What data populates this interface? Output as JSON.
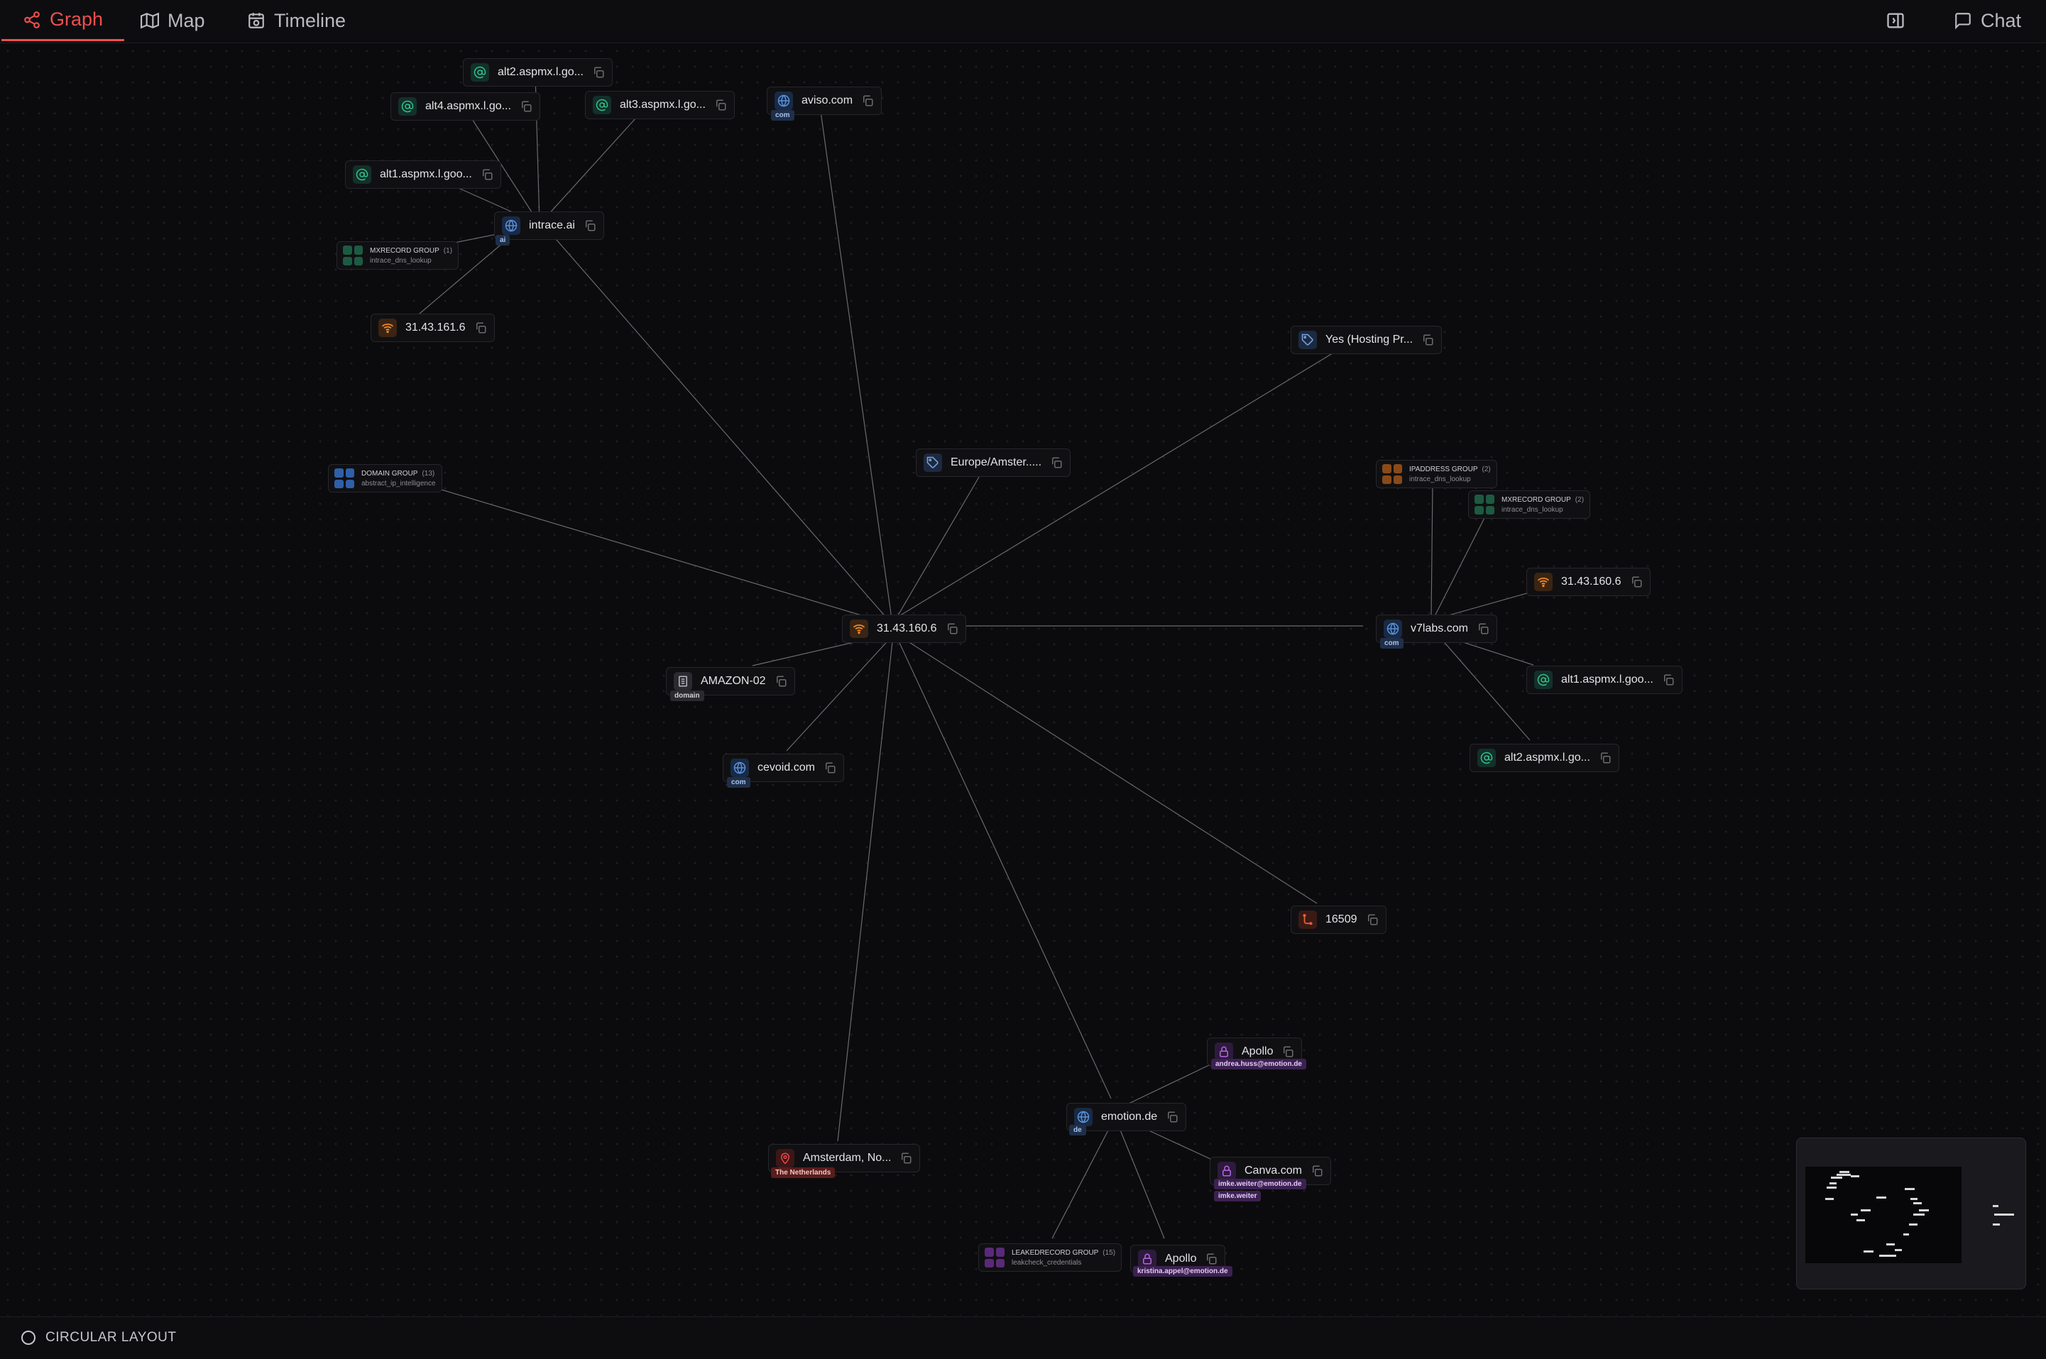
{
  "tabs": [
    {
      "label": "Graph",
      "icon": "graph-icon",
      "active": true
    },
    {
      "label": "Map",
      "icon": "map-icon",
      "active": false
    },
    {
      "label": "Timeline",
      "icon": "timeline-icon",
      "active": false
    }
  ],
  "header_right": {
    "panel_toggle_icon": "panel-toggle-icon",
    "chat_label": "Chat"
  },
  "nodes": {
    "center_ip": {
      "label": "31.43.160.6",
      "icon": "ip-icon"
    },
    "intrace": {
      "label": "intrace.ai",
      "icon": "domain-icon",
      "tag": "ai"
    },
    "alt2_intrace": {
      "label": "alt2.aspmx.l.go...",
      "icon": "mx-icon"
    },
    "alt4_intrace": {
      "label": "alt4.aspmx.l.go...",
      "icon": "mx-icon"
    },
    "alt3_intrace": {
      "label": "alt3.aspmx.l.go...",
      "icon": "mx-icon"
    },
    "alt1_intrace": {
      "label": "alt1.aspmx.l.goo...",
      "icon": "mx-icon"
    },
    "ip_161": {
      "label": "31.43.161.6",
      "icon": "ip-icon"
    },
    "aviso": {
      "label": "aviso.com",
      "icon": "domain-icon",
      "tag": "com"
    },
    "yes_hosting": {
      "label": "Yes (Hosting Pr...",
      "icon": "tag-icon"
    },
    "europe": {
      "label": "Europe/Amster.....",
      "icon": "tag-icon"
    },
    "v7labs": {
      "label": "v7labs.com",
      "icon": "domain-icon",
      "tag": "com"
    },
    "ip_v7": {
      "label": "31.43.160.6",
      "icon": "ip-icon"
    },
    "alt1_v7": {
      "label": "alt1.aspmx.l.goo...",
      "icon": "mx-icon"
    },
    "alt2_v7": {
      "label": "alt2.aspmx.l.go...",
      "icon": "mx-icon"
    },
    "amazon": {
      "label": "AMAZON-02",
      "icon": "building-icon",
      "tag": "domain"
    },
    "cevoid": {
      "label": "cevoid.com",
      "icon": "domain-icon",
      "tag": "com"
    },
    "asn": {
      "label": "16509",
      "icon": "asn-icon"
    },
    "emotion": {
      "label": "emotion.de",
      "icon": "domain-icon",
      "tag": "de"
    },
    "apollo1": {
      "label": "Apollo",
      "icon": "lock-icon",
      "tag": "andrea.huss@emotion.de"
    },
    "canva": {
      "label": "Canva.com",
      "icon": "lock-icon",
      "tag": "imke.weiter@emotion.de",
      "tag2": "imke.weiter"
    },
    "apollo2": {
      "label": "Apollo",
      "icon": "lock-icon",
      "tag": "kristina.appel@emotion.de"
    },
    "amsterdam": {
      "label": "Amsterdam, No...",
      "icon": "location-icon",
      "tag": "The Netherlands"
    }
  },
  "groups": {
    "mx_intrace": {
      "title": "MXRECORD GROUP",
      "count": "(1)",
      "source": "intrace_dns_lookup"
    },
    "domain_group": {
      "title": "DOMAIN GROUP",
      "count": "(13)",
      "source": "abstract_ip_intelligence"
    },
    "ip_group": {
      "title": "IPADDRESS GROUP",
      "count": "(2)",
      "source": "intrace_dns_lookup"
    },
    "mx_v7": {
      "title": "MXRECORD GROUP",
      "count": "(2)",
      "source": "intrace_dns_lookup"
    },
    "leak_group": {
      "title": "LEAKEDRECORD GROUP",
      "count": "(15)",
      "source": "leakcheck_credentials"
    }
  },
  "footer": {
    "layout_label": "CIRCULAR LAYOUT"
  },
  "colors": {
    "accent": "#ef4e4e",
    "domain": "#5b8fd9",
    "mx": "#34c28a",
    "ip": "#f08a2a",
    "lock": "#b566e0",
    "location": "#e64a4a"
  }
}
